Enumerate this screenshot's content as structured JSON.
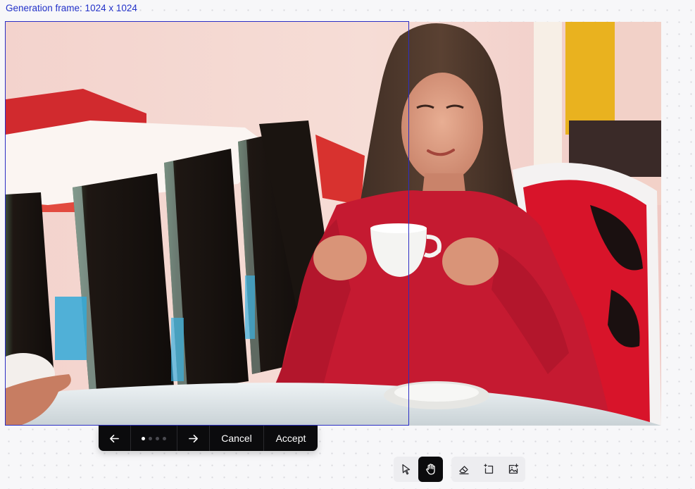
{
  "canvas": {
    "frame_label": "Generation frame: 1024 x 1024"
  },
  "variant_toolbar": {
    "prev_icon": "arrow-left-icon",
    "next_icon": "arrow-right-icon",
    "variant_count": 4,
    "active_variant": 1,
    "cancel_label": "Cancel",
    "accept_label": "Accept"
  },
  "tool_dock": {
    "groups": [
      {
        "tools": [
          {
            "name": "select-tool",
            "icon": "pointer-arrow-icon",
            "active": false
          },
          {
            "name": "pan-tool",
            "icon": "hand-icon",
            "active": true
          }
        ]
      },
      {
        "tools": [
          {
            "name": "erase-tool",
            "icon": "eraser-icon",
            "active": false
          },
          {
            "name": "frame-tool",
            "icon": "add-frame-icon",
            "active": false
          },
          {
            "name": "upload-image-tool",
            "icon": "add-image-icon",
            "active": false
          }
        ]
      }
    ]
  },
  "colors": {
    "frame_border": "#2b2ec4",
    "frame_label": "#2332c9",
    "toolbar_bg": "#0b0b0d",
    "active_tool_bg": "#0b0b0d",
    "dock_bg": "#ededf0"
  }
}
